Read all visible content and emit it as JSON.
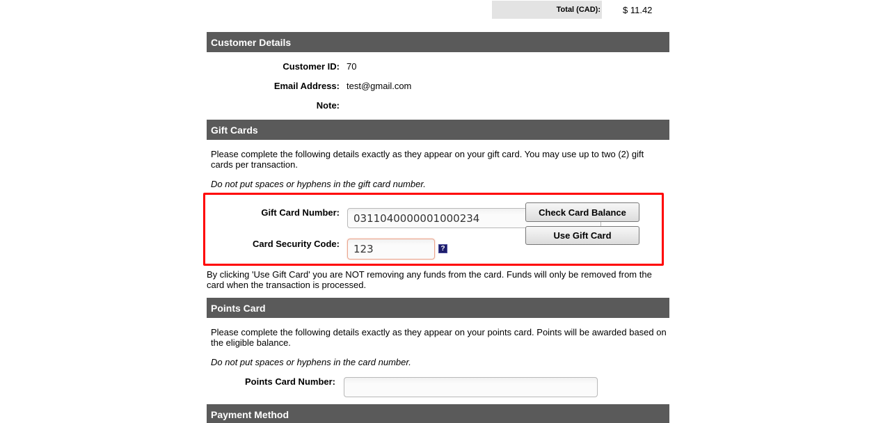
{
  "order": {
    "total_label": "Total (CAD):",
    "total_value": "$ 11.42"
  },
  "customer_details": {
    "header": "Customer Details",
    "customer_id_label": "Customer ID:",
    "customer_id": "70",
    "email_label": "Email Address:",
    "email": "test@gmail.com",
    "note_label": "Note:",
    "note": ""
  },
  "gift_cards": {
    "header": "Gift Cards",
    "instructions": "Please complete the following details exactly as they appear on your gift card. You may use up to two (2) gift cards per transaction.",
    "no_spaces_note": "Do not put spaces or hyphens in the gift card number.",
    "card_number_label": "Gift Card Number:",
    "card_number_value": "0311040000001000234",
    "security_code_label": "Card Security Code:",
    "security_code_value": "123",
    "help_icon_glyph": "?",
    "check_balance_label": "Check Card Balance",
    "use_card_label": "Use Gift Card",
    "disclaimer": "By clicking 'Use Gift Card' you are NOT removing any funds from the card. Funds will only be removed from the card when the transaction is processed.",
    "highlight_color": "#ff0000"
  },
  "points_card": {
    "header": "Points Card",
    "instructions": "Please complete the following details exactly as they appear on your points card.  Points will be awarded based on the eligible balance.",
    "no_spaces_note": "Do not put spaces or hyphens in the card number.",
    "card_number_label": "Points Card Number:",
    "card_number_value": ""
  },
  "payment_method": {
    "header": "Payment Method"
  },
  "colors": {
    "section_header_bg": "#5a5a5a",
    "total_bg": "#e3e3e3"
  }
}
